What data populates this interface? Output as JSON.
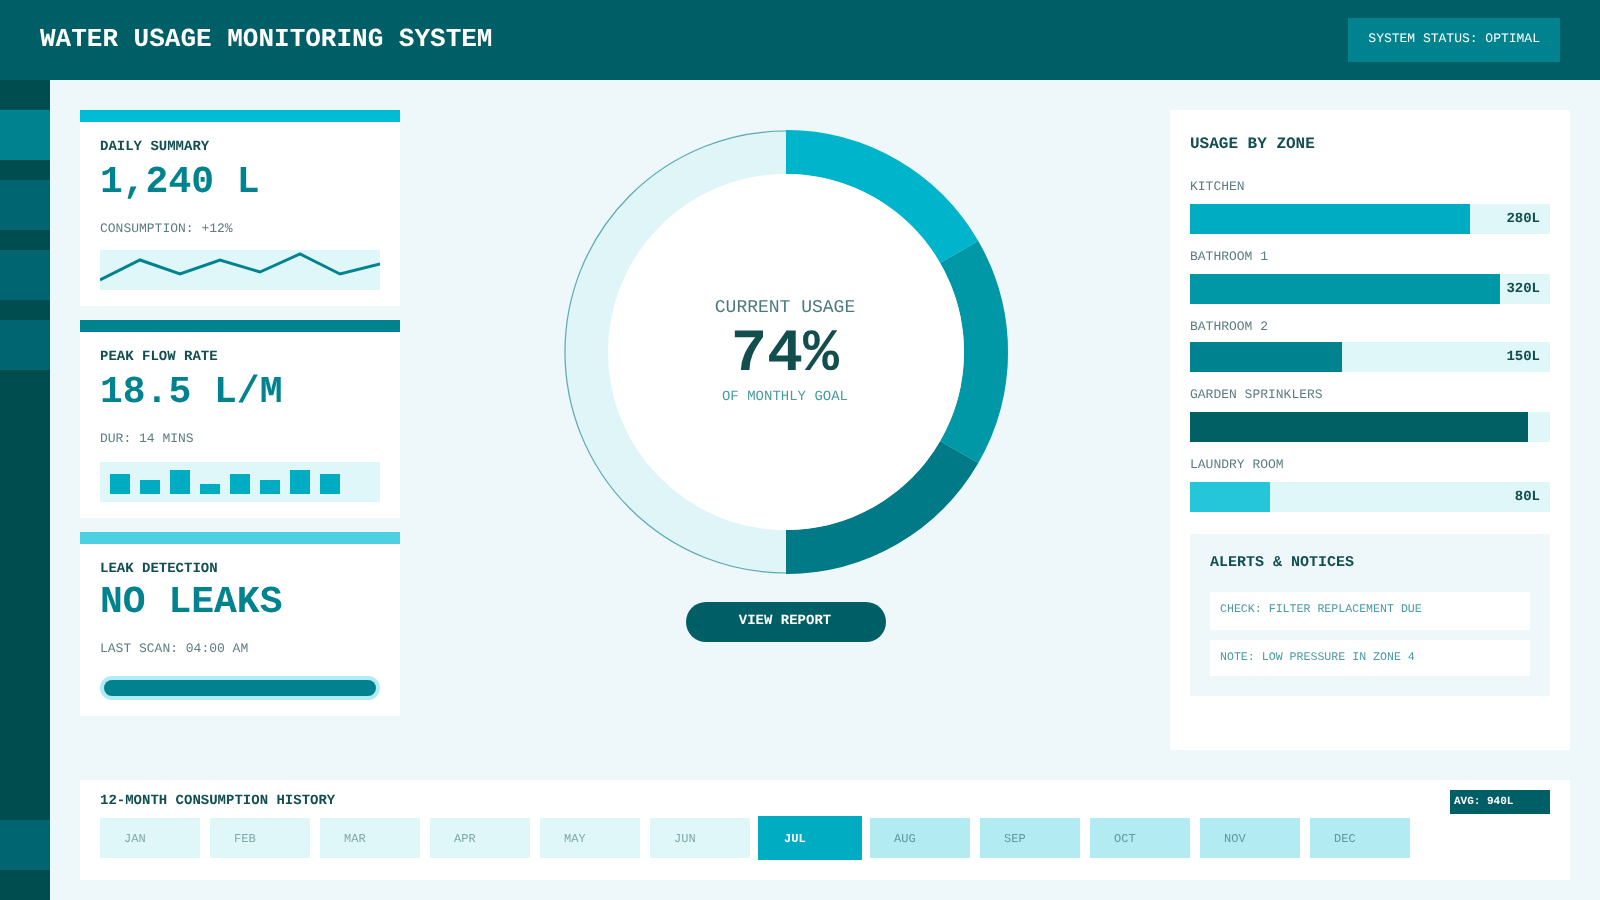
{
  "header": {
    "title": "WATER USAGE MONITORING SYSTEM",
    "status": "SYSTEM STATUS: OPTIMAL"
  },
  "sidebar": {
    "items": [
      {
        "selected": true
      },
      {
        "selected": false
      },
      {
        "selected": false
      },
      {
        "selected": false
      }
    ],
    "footer_item": {
      "selected": false
    }
  },
  "cards": [
    {
      "kind": "sparkline",
      "color": "#00bcd4",
      "title": "DAILY SUMMARY",
      "value": "1,240 L",
      "note": "CONSUMPTION: +12%"
    },
    {
      "kind": "bars",
      "color": "#00838f",
      "title": "PEAK FLOW RATE",
      "value": "18.5 L/M",
      "note": "DUR: 14 MINS"
    },
    {
      "kind": "progress",
      "color": "#4dd0e1",
      "title": "LEAK DETECTION",
      "value": "NO LEAKS",
      "note": "LAST SCAN: 04:00 AM",
      "level": 1
    }
  ],
  "gauge": {
    "label": "CURRENT USAGE",
    "value": "74%",
    "caption": "OF MONTHLY GOAL",
    "button": "VIEW REPORT"
  },
  "zones": {
    "title": "USAGE BY ZONE",
    "items": [
      {
        "name": "KITCHEN",
        "level": 0.78,
        "color": "#00acc1",
        "reading": "280L"
      },
      {
        "name": "BATHROOM 1",
        "level": 0.86,
        "color": "#0097a7",
        "reading": "320L"
      },
      {
        "name": "BATHROOM 2",
        "level": 0.42,
        "color": "#00838f",
        "reading": "150L"
      },
      {
        "name": "GARDEN SPRINKLERS",
        "level": 0.94,
        "color": "#006064"
      },
      {
        "name": "LAUNDRY ROOM",
        "level": 0.22,
        "color": "#26c6da",
        "reading": "80L"
      }
    ]
  },
  "alerts": {
    "title": "ALERTS & NOTICES",
    "items": [
      "CHECK: FILTER REPLACEMENT DUE",
      "NOTE: LOW PRESSURE IN ZONE 4"
    ]
  },
  "history": {
    "title": "12-MONTH CONSUMPTION HISTORY",
    "average": "AVG: 940L",
    "months": [
      {
        "label": "JAN",
        "kind": "past",
        "selected": false
      },
      {
        "label": "FEB",
        "kind": "past",
        "selected": false
      },
      {
        "label": "MAR",
        "kind": "past",
        "selected": false
      },
      {
        "label": "APR",
        "kind": "past",
        "selected": false
      },
      {
        "label": "MAY",
        "kind": "past",
        "selected": false
      },
      {
        "label": "JUN",
        "kind": "past",
        "selected": false
      },
      {
        "label": "JUL",
        "kind": "current",
        "selected": true
      },
      {
        "label": "AUG",
        "kind": "future",
        "selected": false
      },
      {
        "label": "SEP",
        "kind": "future",
        "selected": false
      },
      {
        "label": "OCT",
        "kind": "future",
        "selected": false
      },
      {
        "label": "NOV",
        "kind": "future",
        "selected": false
      },
      {
        "label": "DEC",
        "kind": "future",
        "selected": false
      }
    ]
  }
}
